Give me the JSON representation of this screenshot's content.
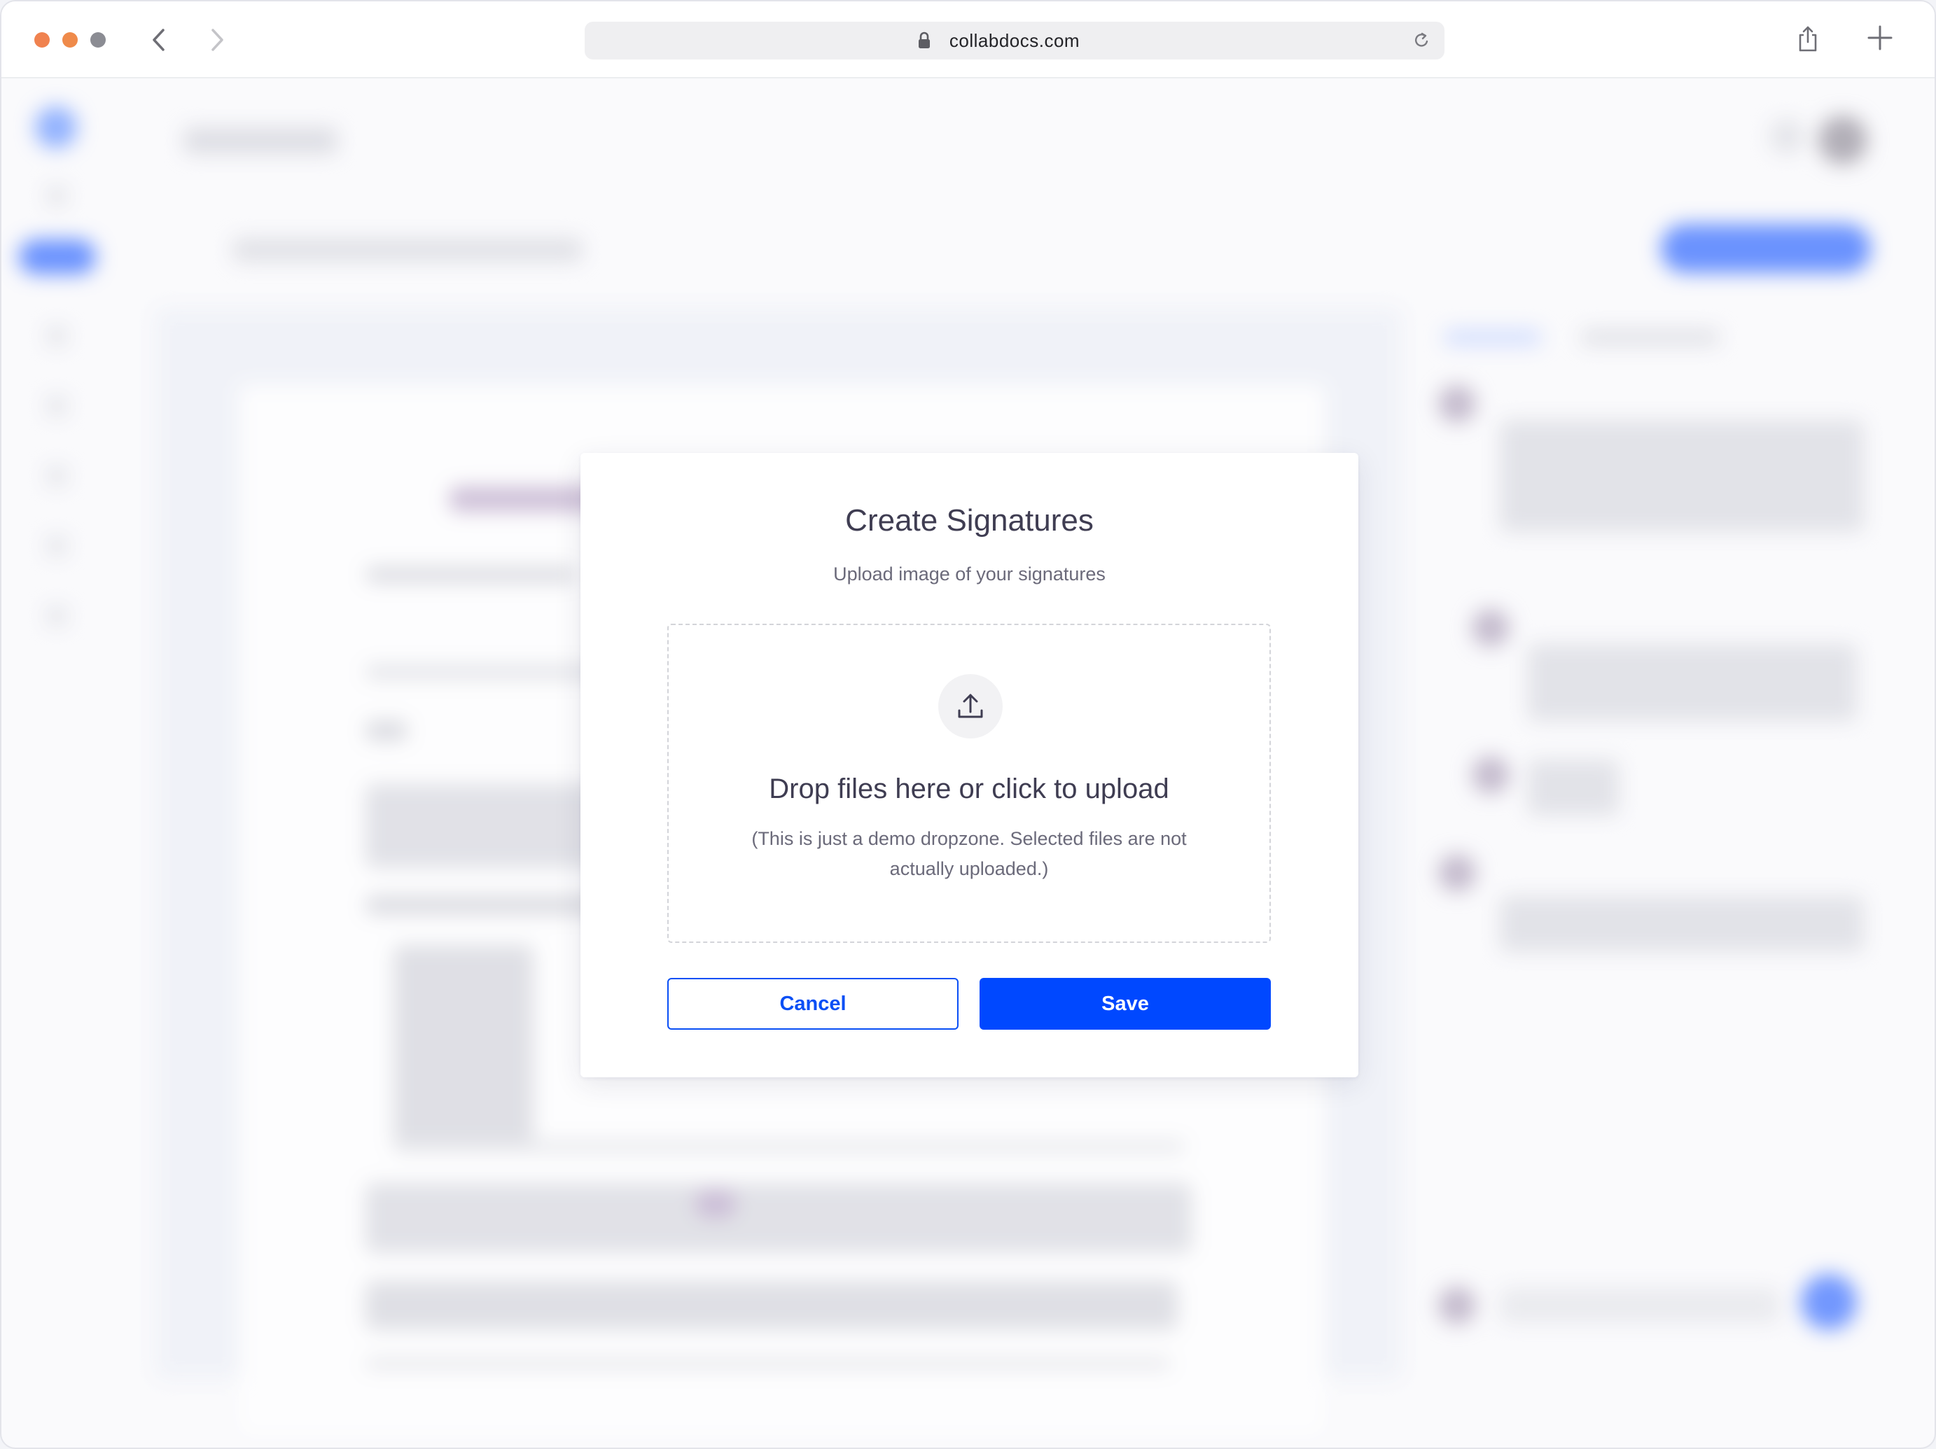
{
  "browser": {
    "url": "collabdocs.com"
  },
  "modal": {
    "title": "Create Signatures",
    "subtitle": "Upload image of your signatures",
    "dropzone": {
      "title": "Drop files here or click to upload",
      "note": "(This is just a demo dropzone. Selected files are not actually uploaded.)",
      "icon": "upload-icon"
    },
    "cancel_label": "Cancel",
    "save_label": "Save"
  },
  "colors": {
    "primary": "#0048ff",
    "text_dark": "#3f3d52",
    "text_muted": "#6b6a7a"
  }
}
